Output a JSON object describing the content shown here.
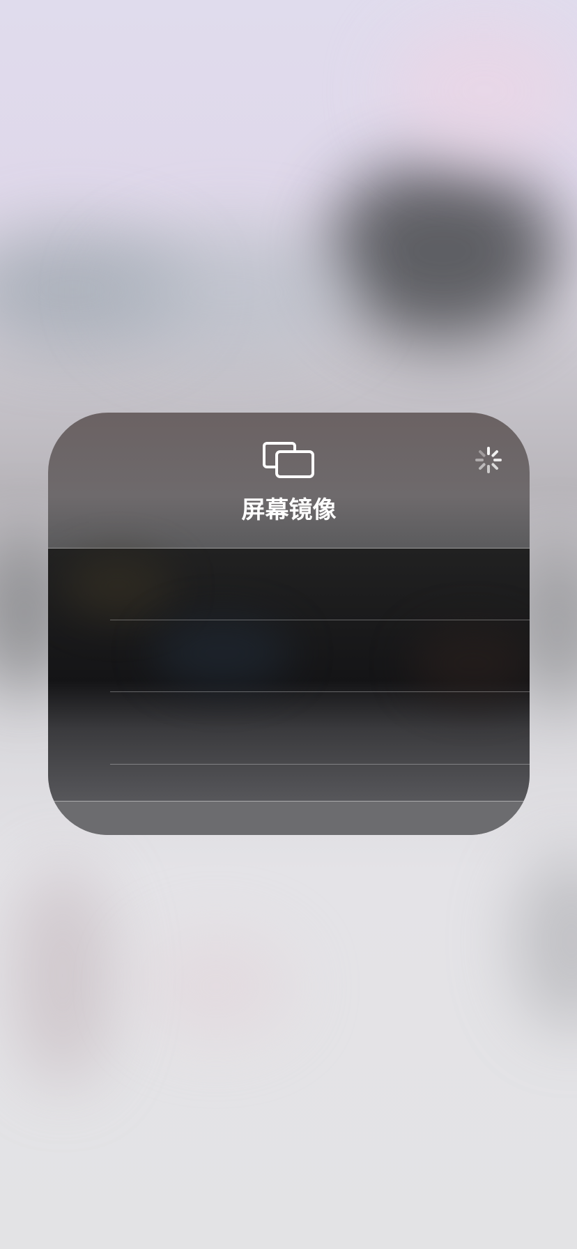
{
  "screen_mirroring": {
    "title": "屏幕镜像",
    "icon": "screen-mirroring-icon",
    "status_icon": "loading-spinner-icon",
    "devices": []
  },
  "colors": {
    "title_text": "#ffffff",
    "card_background": "#6b6a6c",
    "list_background": "#141416"
  }
}
